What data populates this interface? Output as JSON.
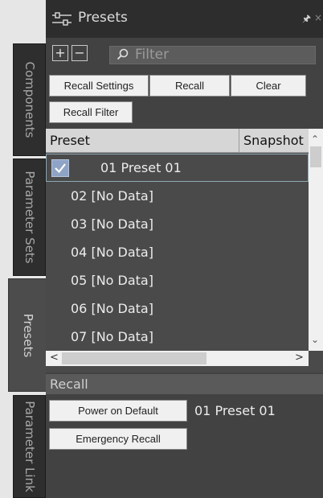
{
  "sidebar": {
    "tabs": [
      {
        "label": "Components"
      },
      {
        "label": "Parameter Sets"
      },
      {
        "label": "Presets"
      },
      {
        "label": "Parameter Link"
      }
    ]
  },
  "panel": {
    "title": "Presets",
    "filter_placeholder": "Filter"
  },
  "toolbar": {
    "recall_settings": "Recall Settings",
    "recall": "Recall",
    "clear": "Clear",
    "recall_filter": "Recall Filter"
  },
  "table": {
    "columns": [
      "Preset",
      "Snapshot"
    ],
    "rows": [
      {
        "label": "01 Preset 01",
        "selected": true
      },
      {
        "label": "02 [No Data]"
      },
      {
        "label": "03 [No Data]"
      },
      {
        "label": "04 [No Data]"
      },
      {
        "label": "05 [No Data]"
      },
      {
        "label": "06 [No Data]"
      },
      {
        "label": "07 [No Data]"
      }
    ]
  },
  "recall": {
    "title": "Recall",
    "power_on_default": "Power on Default",
    "power_on_value": "01 Preset 01",
    "emergency_recall": "Emergency Recall"
  }
}
